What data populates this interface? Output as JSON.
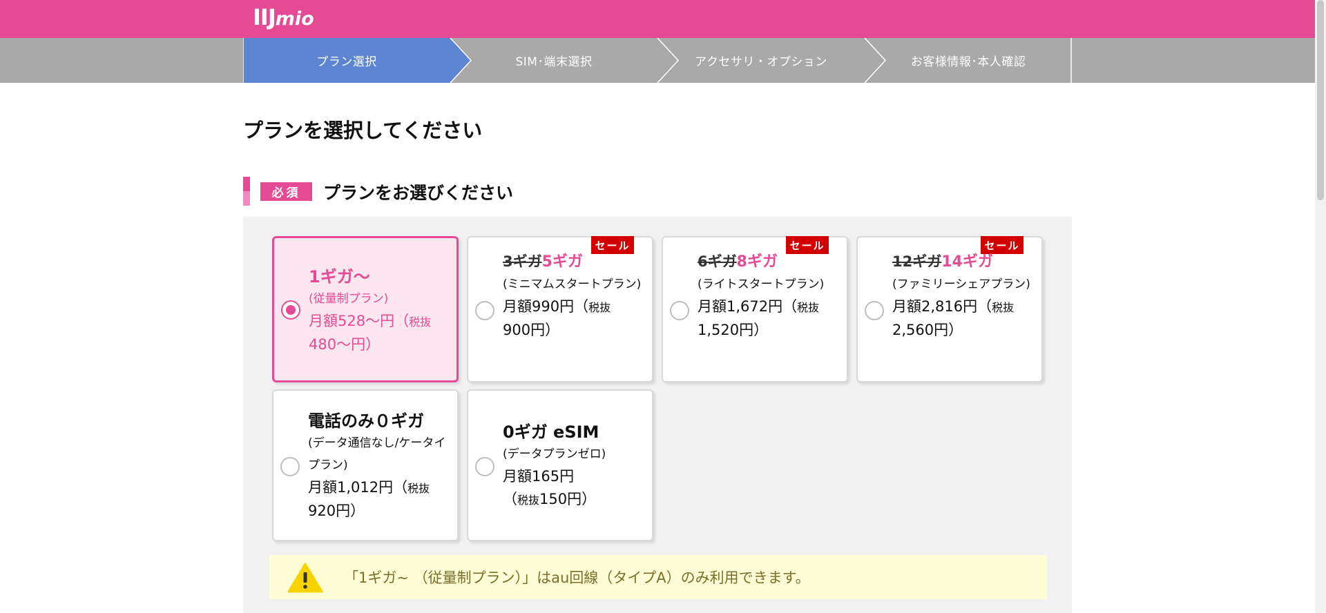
{
  "header": {
    "logo_main": "IIJ",
    "logo_sub": "mio",
    "brand_color": "#e44b94"
  },
  "steps": [
    {
      "label": "プラン選択",
      "active": true
    },
    {
      "label": "SIM･端末選択",
      "active": false
    },
    {
      "label": "アクセサリ・オプション",
      "active": false
    },
    {
      "label": "お客様情報･本人確認",
      "active": false
    }
  ],
  "page": {
    "title": "プランを選択してください"
  },
  "section": {
    "required_label": "必須",
    "title": "プランをお選びください"
  },
  "plans": [
    {
      "title": "1ギガ～",
      "subtitle": "(従量制プラン)",
      "price_main": "月額528～円（",
      "price_small": "税抜",
      "price_tail": "480～円）",
      "selected": true
    },
    {
      "old": "3ギガ",
      "new": "5ギガ",
      "sale_label": "セール",
      "subtitle": "(ミニマムスタートプラン)",
      "price_main": "月額990円（",
      "price_small": "税抜",
      "price_tail": "900円）",
      "selected": false
    },
    {
      "old": "6ギガ",
      "new": "8ギガ",
      "sale_label": "セール",
      "subtitle": "(ライトスタートプラン)",
      "price_main": "月額1,672円（",
      "price_small": "税抜",
      "price_tail": "1,520円）",
      "selected": false
    },
    {
      "old": "12ギガ",
      "new": "14ギガ",
      "sale_label": "セール",
      "subtitle": "(ファミリーシェアプラン)",
      "price_main": "月額2,816円（",
      "price_small": "税抜",
      "price_tail": "2,560円）",
      "selected": false
    },
    {
      "title": "電話のみ０ギガ",
      "subtitle": "(データ通信なし/ケータイプラン)",
      "price_main": "月額1,012円（",
      "price_small": "税抜",
      "price_tail": "920円）",
      "selected": false
    },
    {
      "title": "0ギガ eSIM",
      "subtitle": "(データプランゼロ)",
      "price_main": "月額165円",
      "price_small": "税抜",
      "price_tail": "150円）",
      "selected": false
    }
  ],
  "notice": {
    "icon": "warning-icon",
    "text": "「1ギガ~ （従量制プラン）」はau回線（タイプA）のみ利用できます。"
  },
  "colors": {
    "step_active": "#5d86d2",
    "step_inactive": "#a9a9a9",
    "sale_red": "#d20000",
    "notice_bg": "#fdfdd6"
  }
}
